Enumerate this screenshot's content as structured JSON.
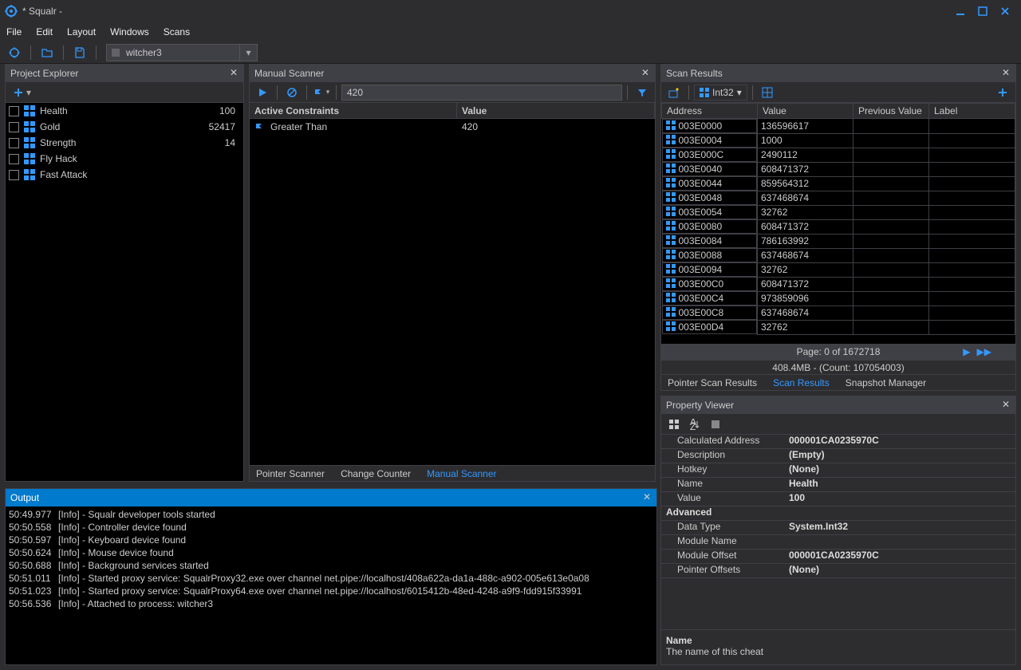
{
  "window": {
    "title": "* Squalr -"
  },
  "menu": [
    "File",
    "Edit",
    "Layout",
    "Windows",
    "Scans"
  ],
  "process": {
    "name": "witcher3"
  },
  "panels": {
    "project_explorer": {
      "title": "Project Explorer"
    },
    "manual_scanner": {
      "title": "Manual Scanner"
    },
    "scan_results": {
      "title": "Scan Results"
    },
    "output": {
      "title": "Output"
    },
    "property_viewer": {
      "title": "Property Viewer"
    }
  },
  "project_items": [
    {
      "name": "Health",
      "value": "100"
    },
    {
      "name": "Gold",
      "value": "52417"
    },
    {
      "name": "Strength",
      "value": "14"
    },
    {
      "name": "Fly Hack",
      "value": ""
    },
    {
      "name": "Fast Attack",
      "value": ""
    }
  ],
  "scanner": {
    "value_input": "420",
    "constraints_hdr": [
      "Active Constraints",
      "Value"
    ],
    "constraints": [
      {
        "name": "Greater Than",
        "value": "420"
      }
    ],
    "tabs": [
      "Pointer Scanner",
      "Change Counter",
      "Manual Scanner"
    ],
    "active_tab": "Manual Scanner"
  },
  "scan_results": {
    "type_label": "Int32",
    "columns": [
      "Address",
      "Value",
      "Previous Value",
      "Label"
    ],
    "rows": [
      {
        "addr": "003E0000",
        "val": "136596617"
      },
      {
        "addr": "003E0004",
        "val": "1000"
      },
      {
        "addr": "003E000C",
        "val": "2490112"
      },
      {
        "addr": "003E0040",
        "val": "608471372"
      },
      {
        "addr": "003E0044",
        "val": "859564312"
      },
      {
        "addr": "003E0048",
        "val": "637468674"
      },
      {
        "addr": "003E0054",
        "val": "32762"
      },
      {
        "addr": "003E0080",
        "val": "608471372"
      },
      {
        "addr": "003E0084",
        "val": "786163992"
      },
      {
        "addr": "003E0088",
        "val": "637468674"
      },
      {
        "addr": "003E0094",
        "val": "32762"
      },
      {
        "addr": "003E00C0",
        "val": "608471372"
      },
      {
        "addr": "003E00C4",
        "val": "973859096"
      },
      {
        "addr": "003E00C8",
        "val": "637468674"
      },
      {
        "addr": "003E00D4",
        "val": "32762"
      }
    ],
    "pager": "Page: 0 of 1672718",
    "stats": "408.4MB - (Count: 107054003)",
    "tabs": [
      "Pointer Scan Results",
      "Scan Results",
      "Snapshot Manager"
    ],
    "active_tab": "Scan Results"
  },
  "properties": {
    "rows": [
      {
        "k": "Calculated Address",
        "v": "000001CA0235970C"
      },
      {
        "k": "Description",
        "v": "(Empty)"
      },
      {
        "k": "Hotkey",
        "v": "(None)"
      },
      {
        "k": "Name",
        "v": "Health"
      },
      {
        "k": "Value",
        "v": "100"
      }
    ],
    "advanced_label": "Advanced",
    "adv_rows": [
      {
        "k": "Data Type",
        "v": "System.Int32"
      },
      {
        "k": "Module Name",
        "v": ""
      },
      {
        "k": "Module Offset",
        "v": "000001CA0235970C"
      },
      {
        "k": "Pointer Offsets",
        "v": "(None)"
      }
    ],
    "desc": {
      "title": "Name",
      "text": "The name of this cheat"
    }
  },
  "output": [
    {
      "ts": "50:49.977",
      "msg": "[Info] - Squalr developer tools started"
    },
    {
      "ts": "50:50.558",
      "msg": "[Info] - Controller device found"
    },
    {
      "ts": "50:50.597",
      "msg": "[Info] - Keyboard device found"
    },
    {
      "ts": "50:50.624",
      "msg": "[Info] - Mouse device found"
    },
    {
      "ts": "50:50.688",
      "msg": "[Info] - Background services started"
    },
    {
      "ts": "50:51.011",
      "msg": "[Info] - Started proxy service: SqualrProxy32.exe over channel net.pipe://localhost/408a622a-da1a-488c-a902-005e613e0a08"
    },
    {
      "ts": "50:51.023",
      "msg": "[Info] - Started proxy service: SqualrProxy64.exe over channel net.pipe://localhost/6015412b-48ed-4248-a9f9-fdd915f33991"
    },
    {
      "ts": "50:56.536",
      "msg": "[Info] - Attached to process: witcher3"
    }
  ]
}
